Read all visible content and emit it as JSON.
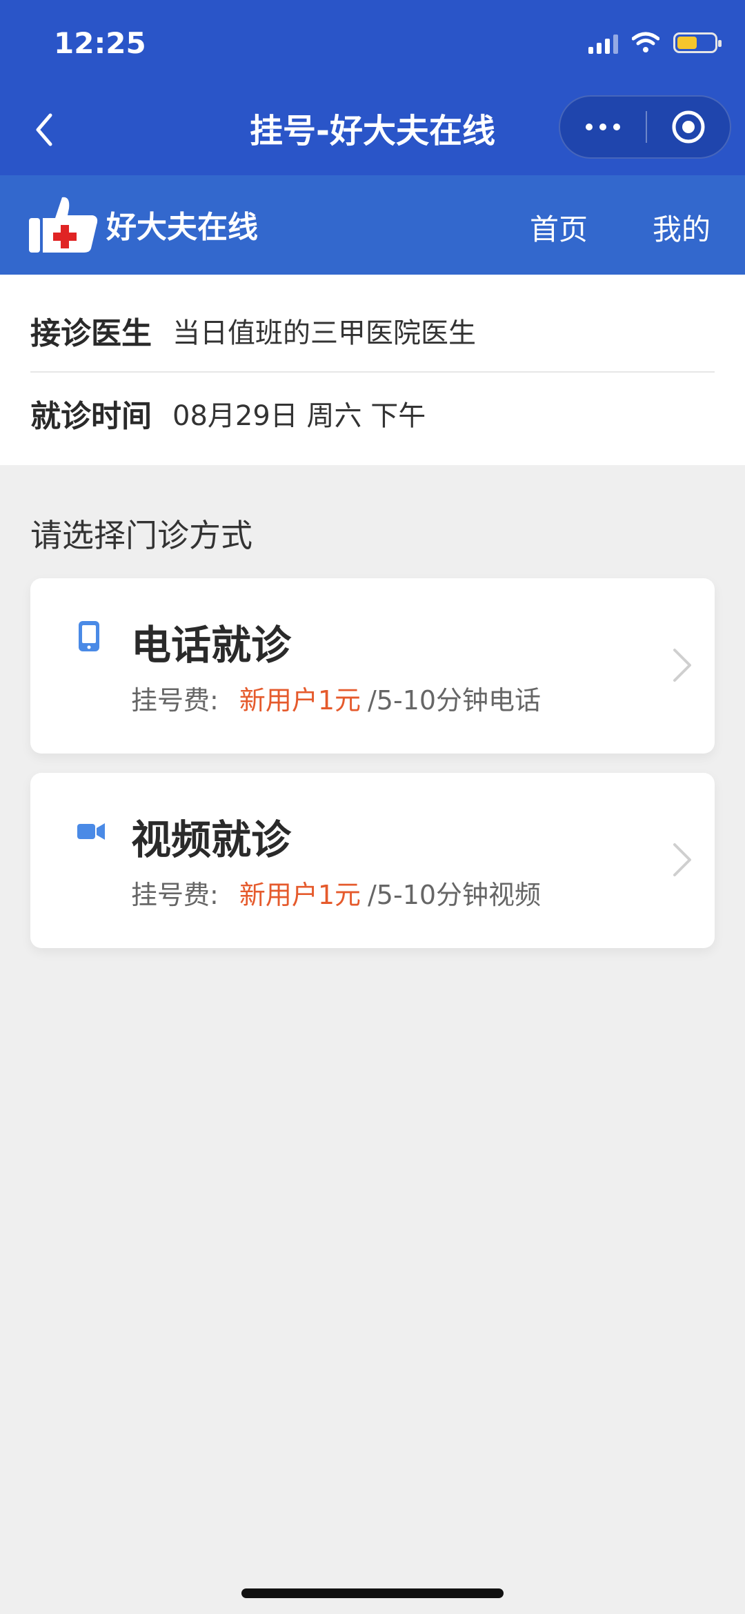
{
  "status_bar": {
    "time": "12:25"
  },
  "nav": {
    "title": "挂号-好大夫在线"
  },
  "brand": {
    "logo_text": "好大夫在线",
    "menu": [
      "首页",
      "我的"
    ]
  },
  "info": [
    {
      "label": "接诊医生",
      "value": "当日值班的三甲医院医生"
    },
    {
      "label": "就诊时间",
      "value": "08月29日 周六 下午"
    }
  ],
  "section_title": "请选择门诊方式",
  "options": [
    {
      "icon": "phone-icon",
      "title": "电话就诊",
      "fee_label": "挂号费:",
      "price": "新用户1元",
      "detail": "/5-10分钟电话"
    },
    {
      "icon": "video-camera-icon",
      "title": "视频就诊",
      "fee_label": "挂号费:",
      "price": "新用户1元",
      "detail": "/5-10分钟视频"
    }
  ],
  "colors": {
    "primary_blue": "#2a55c8",
    "brand_blue": "#3368cd",
    "price_orange": "#e55a2c",
    "icon_blue": "#4a8ae6"
  }
}
